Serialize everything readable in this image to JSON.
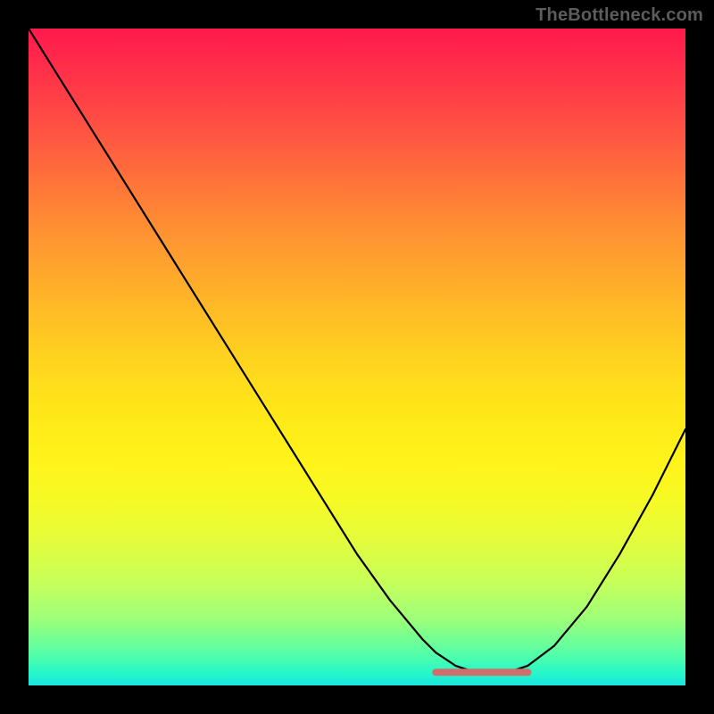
{
  "watermark": "TheBottleneck.com",
  "chart_data": {
    "type": "line",
    "title": "",
    "xlabel": "",
    "ylabel": "",
    "xlim": [
      0,
      100
    ],
    "ylim": [
      0,
      100
    ],
    "grid": false,
    "series": [
      {
        "name": "bottleneck-curve",
        "x": [
          0,
          5,
          10,
          15,
          20,
          25,
          30,
          35,
          40,
          45,
          50,
          55,
          60,
          62,
          65,
          68,
          70,
          73,
          76,
          80,
          85,
          90,
          95,
          100
        ],
        "y": [
          100,
          92,
          84,
          76,
          68,
          60,
          52,
          44,
          36,
          28,
          20,
          13,
          7,
          5,
          3,
          2,
          2,
          2,
          3,
          6,
          12,
          20,
          29,
          39
        ]
      }
    ],
    "highlight": {
      "name": "optimal-flat-region",
      "color": "#cf6e6c",
      "x": [
        62,
        76
      ],
      "y": [
        2,
        2
      ]
    },
    "background": "heatmap-gradient-vertical",
    "colors": {
      "top": "#ff1a4d",
      "mid": "#ffe030",
      "bottom": "#1ae6e0"
    }
  }
}
